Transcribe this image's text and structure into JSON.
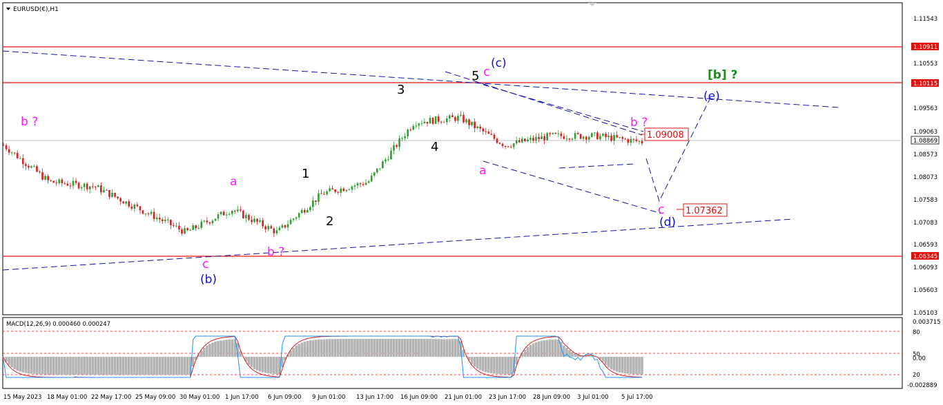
{
  "header": {
    "symbol_label": "EURUSD(€),H1",
    "dropdown_icon": "triangle-down-icon"
  },
  "colors": {
    "bull": "#2e9e2e",
    "bear": "#d42020",
    "trendline": "#1010b0",
    "support_resistance": "#e01010",
    "wave_magenta": "#ff19ff",
    "wave_blue": "#1010d0",
    "wave_green": "#1d8a1d",
    "macd_line": "#1e90ff",
    "signal_line": "#d42020",
    "histogram": "#b4b4b4"
  },
  "price_axis": {
    "ticks": [
      "1.11543",
      "1.10553",
      "1.09563",
      "1.09063",
      "1.08573",
      "1.08073",
      "1.07583",
      "1.07083",
      "1.06593",
      "1.06093",
      "1.05603",
      "1.05103"
    ],
    "levels": [
      {
        "label": "1.10911",
        "kind": "red"
      },
      {
        "label": "1.10115",
        "kind": "red"
      },
      {
        "label": "1.08869",
        "kind": "current"
      },
      {
        "label": "1.06345",
        "kind": "red"
      }
    ]
  },
  "time_axis": {
    "labels": [
      "15 May 2023",
      "18 May 01:00",
      "22 May 17:00",
      "25 May 09:00",
      "30 May 01:00",
      "1 Jun 17:00",
      "6 Jun 09:00",
      "9 Jun 01:00",
      "13 Jun 17:00",
      "16 Jun 09:00",
      "21 Jun 01:00",
      "23 Jun 17:00",
      "28 Jun 09:00",
      "3 Jul 01:00",
      "5 Jul 17:00"
    ]
  },
  "wave_labels": {
    "b_q_left": "b ?",
    "a_left": "a",
    "c_low": "c",
    "b_paren": "(b)",
    "b_q_low": "b ?",
    "w1": "1",
    "w2": "2",
    "w3": "3",
    "w4": "4",
    "w5": "5",
    "c_top": "c",
    "c_paren": "(c)",
    "a_mid": "a",
    "b_q_right": "b ?",
    "c_right": "c",
    "d_paren": "(d)",
    "e_paren": "(e)",
    "b_bracket": "[b] ?"
  },
  "price_boxes": {
    "upper": "1.09008",
    "lower": "1.07362"
  },
  "macd": {
    "title": "MACD(12,26,9) 0.000460 0.000247",
    "ticks": [
      "0.003715",
      "80",
      "50",
      "0.00",
      "20",
      "-0.002889"
    ]
  },
  "chart_data": {
    "type": "line",
    "title": "EURUSD(€),H1",
    "xlabel": "",
    "ylabel": "",
    "ylim": [
      1.05103,
      1.11543
    ],
    "x": [
      "15 May 2023",
      "18 May 01:00",
      "22 May 17:00",
      "25 May 09:00",
      "30 May 01:00",
      "1 Jun 17:00",
      "6 Jun 09:00",
      "9 Jun 01:00",
      "13 Jun 17:00",
      "16 Jun 09:00",
      "21 Jun 01:00",
      "23 Jun 17:00",
      "28 Jun 09:00",
      "3 Jul 01:00",
      "5 Jul 17:00"
    ],
    "series": [
      {
        "values": [
          1.088,
          1.08,
          1.079,
          1.074,
          1.069,
          1.074,
          1.069,
          1.0775,
          1.08,
          1.093,
          1.094,
          1.088,
          1.09,
          1.09,
          1.0887
        ]
      }
    ],
    "horizontal_levels": [
      1.10911,
      1.10115,
      1.06345
    ],
    "current_price": 1.08869,
    "grid": false
  }
}
